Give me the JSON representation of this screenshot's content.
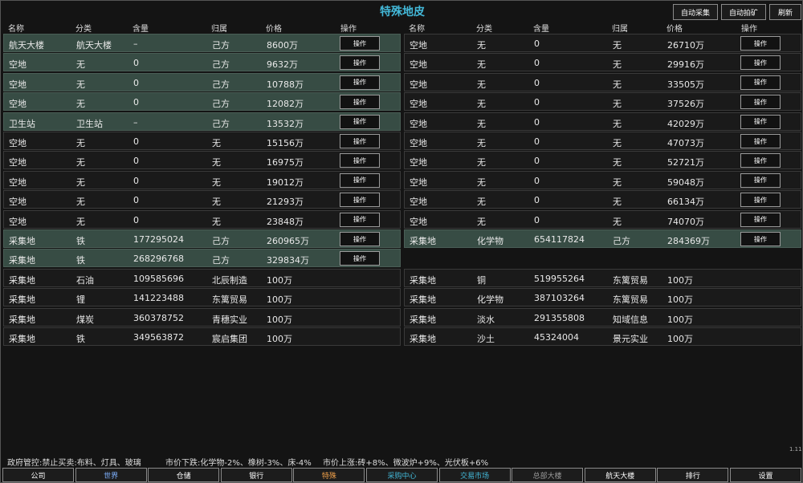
{
  "title": "特殊地皮",
  "toolbar": {
    "auto_collect": "自动采集",
    "auto_bid": "自动拍矿",
    "refresh": "刷新"
  },
  "columns": [
    "名称",
    "分类",
    "含量",
    "归属",
    "价格",
    "操作"
  ],
  "action_label": "操作",
  "left_rows": [
    {
      "name": "航天大楼",
      "category": "航天大楼",
      "amount": "–",
      "owner": "己方",
      "price": "8600万",
      "own": true,
      "action": true
    },
    {
      "name": "空地",
      "category": "无",
      "amount": "0",
      "owner": "己方",
      "price": "9632万",
      "own": true,
      "action": true
    },
    {
      "name": "空地",
      "category": "无",
      "amount": "0",
      "owner": "己方",
      "price": "10788万",
      "own": true,
      "action": true
    },
    {
      "name": "空地",
      "category": "无",
      "amount": "0",
      "owner": "己方",
      "price": "12082万",
      "own": true,
      "action": true
    },
    {
      "name": "卫生站",
      "category": "卫生站",
      "amount": "–",
      "owner": "己方",
      "price": "13532万",
      "own": true,
      "action": true
    },
    {
      "name": "空地",
      "category": "无",
      "amount": "0",
      "owner": "无",
      "price": "15156万",
      "own": false,
      "action": true
    },
    {
      "name": "空地",
      "category": "无",
      "amount": "0",
      "owner": "无",
      "price": "16975万",
      "own": false,
      "action": true
    },
    {
      "name": "空地",
      "category": "无",
      "amount": "0",
      "owner": "无",
      "price": "19012万",
      "own": false,
      "action": true
    },
    {
      "name": "空地",
      "category": "无",
      "amount": "0",
      "owner": "无",
      "price": "21293万",
      "own": false,
      "action": true
    },
    {
      "name": "空地",
      "category": "无",
      "amount": "0",
      "owner": "无",
      "price": "23848万",
      "own": false,
      "action": true
    },
    {
      "name": "采集地",
      "category": "铁",
      "amount": "177295024",
      "owner": "己方",
      "price": "260965万",
      "own": true,
      "action": true
    },
    {
      "name": "采集地",
      "category": "铁",
      "amount": "268296768",
      "owner": "己方",
      "price": "329834万",
      "own": true,
      "action": true
    },
    {
      "name": "采集地",
      "category": "石油",
      "amount": "109585696",
      "owner": "北辰制造",
      "price": "100万",
      "own": false,
      "action": false
    },
    {
      "name": "采集地",
      "category": "锂",
      "amount": "141223488",
      "owner": "东篱贸易",
      "price": "100万",
      "own": false,
      "action": false
    },
    {
      "name": "采集地",
      "category": "煤炭",
      "amount": "360378752",
      "owner": "青穗实业",
      "price": "100万",
      "own": false,
      "action": false
    },
    {
      "name": "采集地",
      "category": "铁",
      "amount": "349563872",
      "owner": "宸启集团",
      "price": "100万",
      "own": false,
      "action": false
    }
  ],
  "right_rows": [
    {
      "name": "空地",
      "category": "无",
      "amount": "0",
      "owner": "无",
      "price": "26710万",
      "own": false,
      "action": true
    },
    {
      "name": "空地",
      "category": "无",
      "amount": "0",
      "owner": "无",
      "price": "29916万",
      "own": false,
      "action": true
    },
    {
      "name": "空地",
      "category": "无",
      "amount": "0",
      "owner": "无",
      "price": "33505万",
      "own": false,
      "action": true
    },
    {
      "name": "空地",
      "category": "无",
      "amount": "0",
      "owner": "无",
      "price": "37526万",
      "own": false,
      "action": true
    },
    {
      "name": "空地",
      "category": "无",
      "amount": "0",
      "owner": "无",
      "price": "42029万",
      "own": false,
      "action": true
    },
    {
      "name": "空地",
      "category": "无",
      "amount": "0",
      "owner": "无",
      "price": "47073万",
      "own": false,
      "action": true
    },
    {
      "name": "空地",
      "category": "无",
      "amount": "0",
      "owner": "无",
      "price": "52721万",
      "own": false,
      "action": true
    },
    {
      "name": "空地",
      "category": "无",
      "amount": "0",
      "owner": "无",
      "price": "59048万",
      "own": false,
      "action": true
    },
    {
      "name": "空地",
      "category": "无",
      "amount": "0",
      "owner": "无",
      "price": "66134万",
      "own": false,
      "action": true
    },
    {
      "name": "空地",
      "category": "无",
      "amount": "0",
      "owner": "无",
      "price": "74070万",
      "own": false,
      "action": true
    },
    {
      "name": "采集地",
      "category": "化学物",
      "amount": "654117824",
      "owner": "己方",
      "price": "284369万",
      "own": true,
      "action": true
    },
    null,
    {
      "name": "采集地",
      "category": "铜",
      "amount": "519955264",
      "owner": "东篱贸易",
      "price": "100万",
      "own": false,
      "action": false
    },
    {
      "name": "采集地",
      "category": "化学物",
      "amount": "387103264",
      "owner": "东篱贸易",
      "price": "100万",
      "own": false,
      "action": false
    },
    {
      "name": "采集地",
      "category": "淡水",
      "amount": "291355808",
      "owner": "知域信息",
      "price": "100万",
      "own": false,
      "action": false
    },
    {
      "name": "采集地",
      "category": "沙土",
      "amount": "45324004",
      "owner": "景元实业",
      "price": "100万",
      "own": false,
      "action": false
    }
  ],
  "status": {
    "policy": "政府管控:禁止买卖:布料、灯具、玻璃",
    "price_down": "市价下跌:化学物-2%、橡树-3%、床-4%",
    "price_up": "市价上涨:砖+8%、微波炉+9%、光伏板+6%"
  },
  "version": "1.11",
  "nav": [
    {
      "label": "公司",
      "color": "#ffffff"
    },
    {
      "label": "世界",
      "color": "#7fb2ff"
    },
    {
      "label": "仓储",
      "color": "#ffffff"
    },
    {
      "label": "银行",
      "color": "#ffffff"
    },
    {
      "label": "特殊",
      "color": "#f2a14a"
    },
    {
      "label": "采购中心",
      "color": "#43b8d8"
    },
    {
      "label": "交易市场",
      "color": "#43b8d8"
    },
    {
      "label": "总部大楼",
      "color": "#9a9a9a"
    },
    {
      "label": "航天大楼",
      "color": "#ffffff"
    },
    {
      "label": "排行",
      "color": "#ffffff"
    },
    {
      "label": "设置",
      "color": "#ffffff"
    }
  ],
  "colors": {
    "accent": "#43b8d8",
    "own_row": "#374c44"
  }
}
